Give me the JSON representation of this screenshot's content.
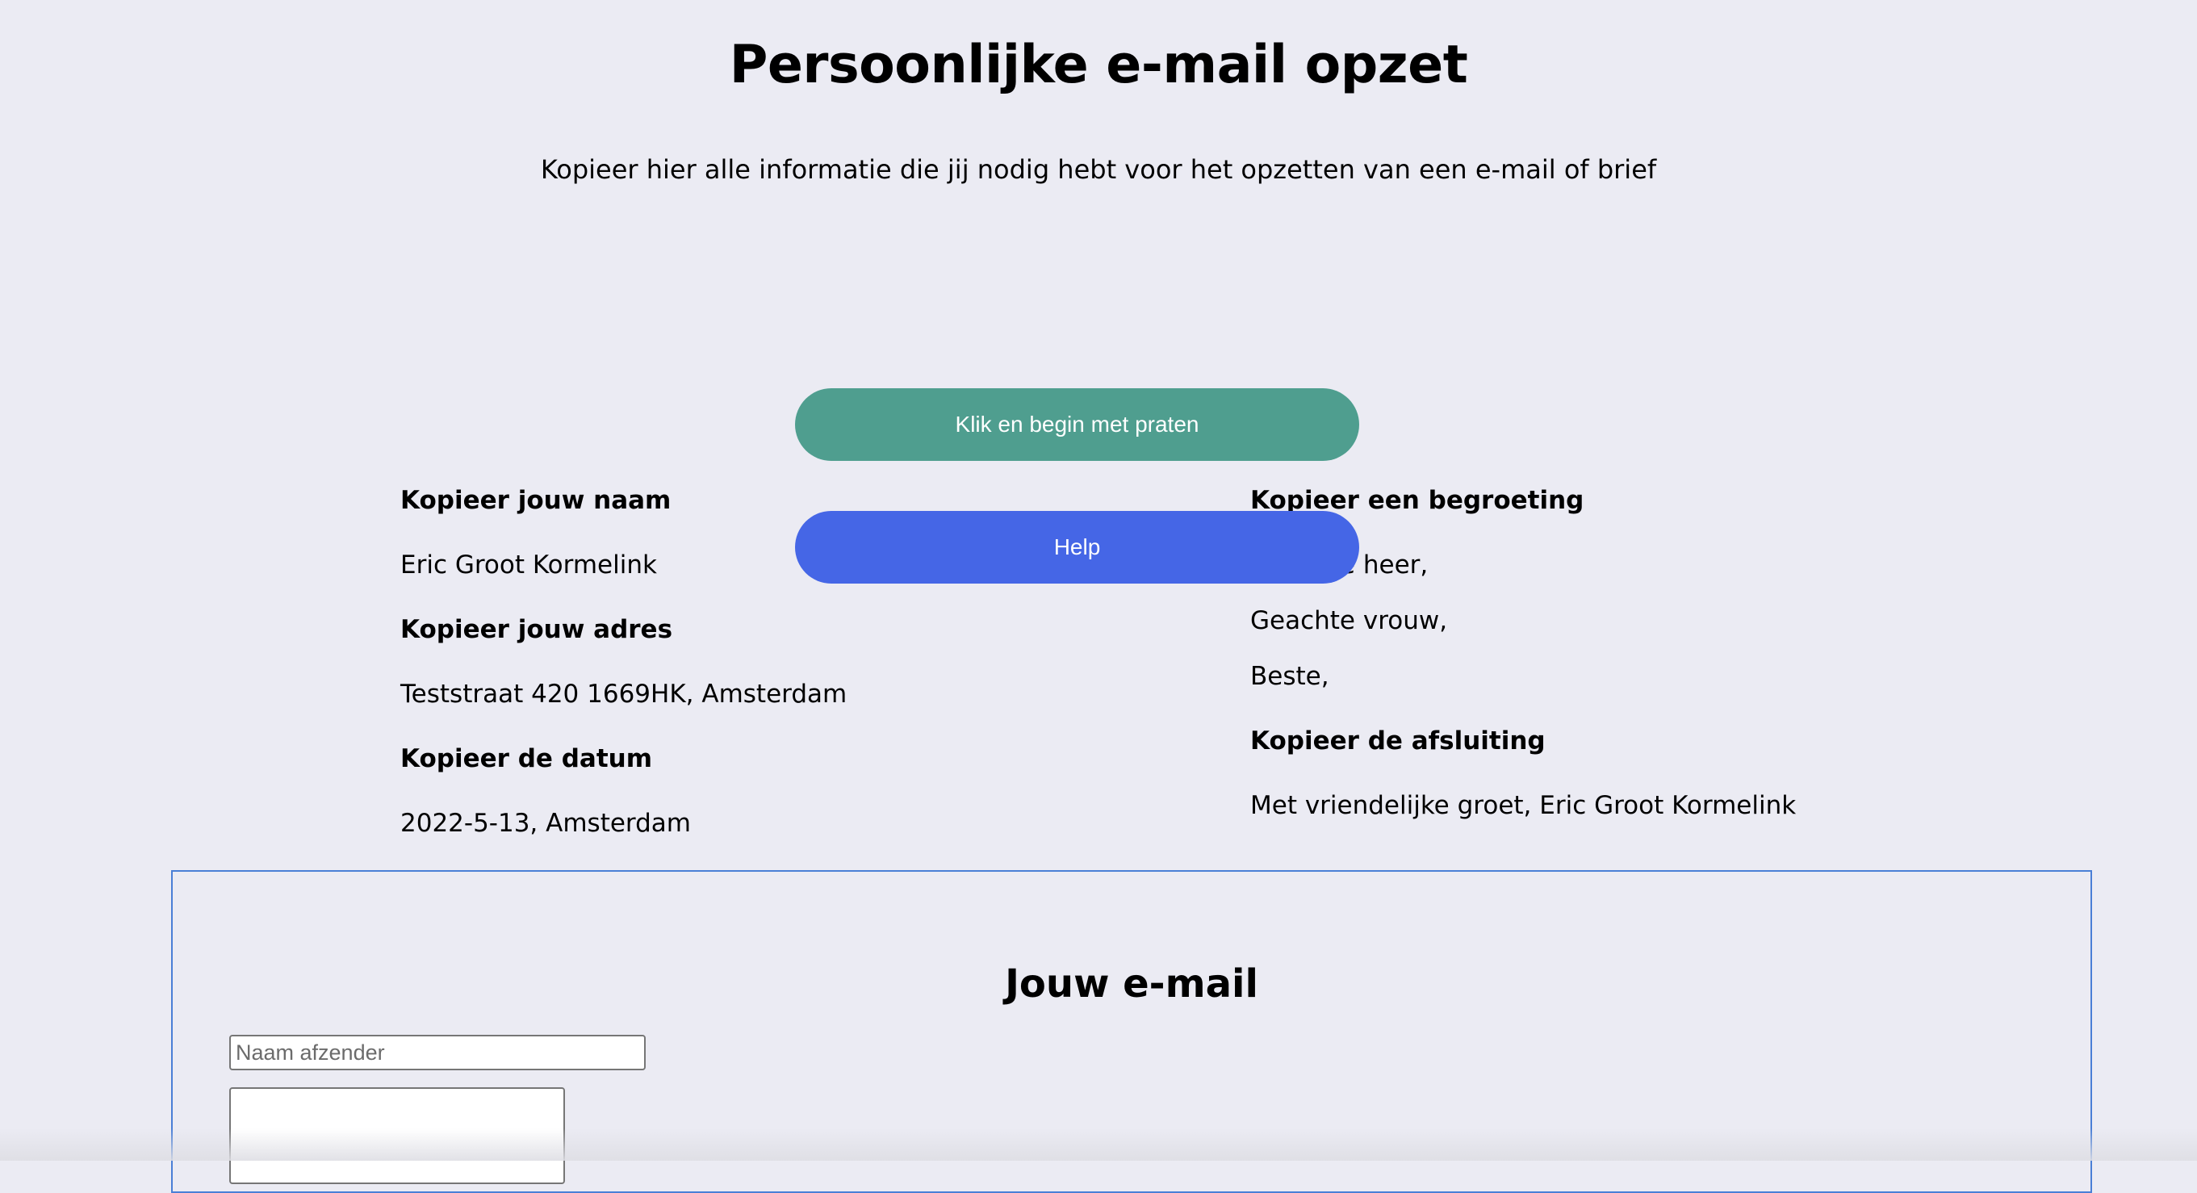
{
  "header": {
    "title": "Persoonlijke e-mail opzet",
    "subtitle": "Kopieer hier alle informatie die jij nodig hebt voor het opzetten van een e-mail of brief"
  },
  "buttons": {
    "talk_label": "Klik en begin met praten",
    "help_label": "Help"
  },
  "left_column": {
    "name_heading": "Kopieer jouw naam",
    "name_value": "Eric Groot Kormelink",
    "address_heading": "Kopieer jouw adres",
    "address_value": "Teststraat 420 1669HK, Amsterdam",
    "date_heading": "Kopieer de datum",
    "date_value": "2022-5-13, Amsterdam"
  },
  "right_column": {
    "greeting_heading": "Kopieer een begroeting",
    "greetings": [
      "Geachte heer,",
      "Geachte vrouw,",
      "Beste,"
    ],
    "closing_heading": "Kopieer de afsluiting",
    "closing_value": "Met vriendelijke groet, Eric Groot Kormelink"
  },
  "email_form": {
    "title": "Jouw e-mail",
    "sender_placeholder": "Naam afzender",
    "sender_value": "",
    "message_value": ""
  },
  "colors": {
    "background": "#ebebf3",
    "talk_button": "#4f9e8f",
    "help_button": "#4566e6",
    "email_border": "#4a7fd6"
  }
}
